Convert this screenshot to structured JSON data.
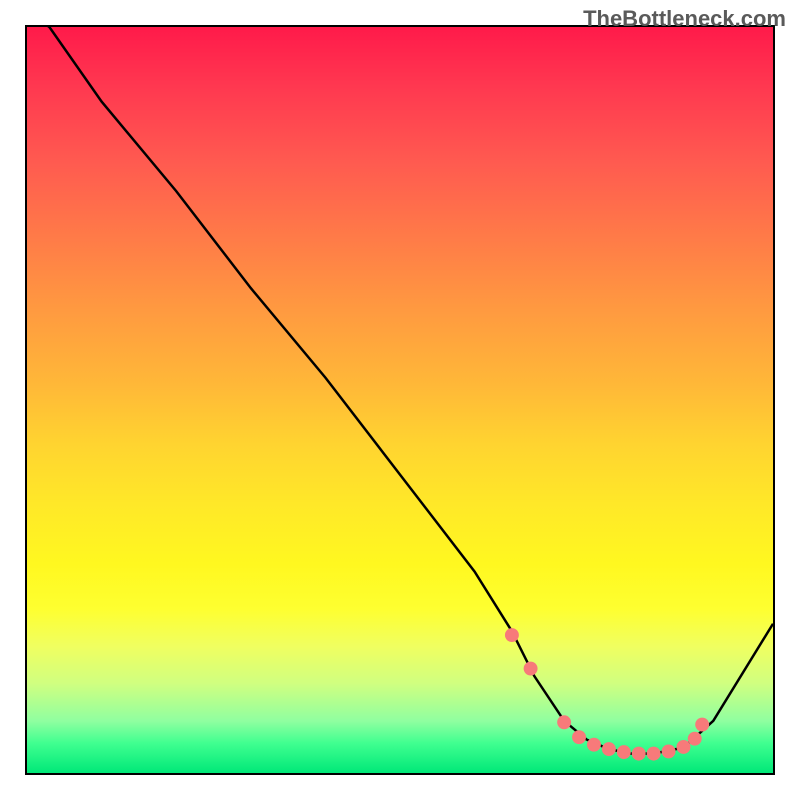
{
  "watermark": "TheBottleneck.com",
  "chart_data": {
    "type": "line",
    "title": "",
    "xlabel": "",
    "ylabel": "",
    "xlim": [
      0,
      100
    ],
    "ylim": [
      0,
      100
    ],
    "series": [
      {
        "name": "curve",
        "x": [
          0,
          3,
          10,
          20,
          30,
          40,
          50,
          60,
          65,
          68,
          72,
          75,
          78,
          81,
          84,
          88,
          92,
          100
        ],
        "values": [
          102,
          100,
          90,
          78,
          65,
          53,
          40,
          27,
          19,
          13,
          7,
          4.5,
          3.2,
          2.6,
          2.6,
          3.4,
          7,
          20
        ]
      }
    ],
    "markers": {
      "name": "highlight-dots",
      "color": "#f77a7a",
      "x": [
        65,
        67.5,
        72,
        74,
        76,
        78,
        80,
        82,
        84,
        86,
        88,
        89.5,
        90.5
      ],
      "values": [
        18.5,
        14,
        6.8,
        4.8,
        3.8,
        3.2,
        2.8,
        2.6,
        2.6,
        2.9,
        3.5,
        4.6,
        6.5
      ]
    }
  }
}
